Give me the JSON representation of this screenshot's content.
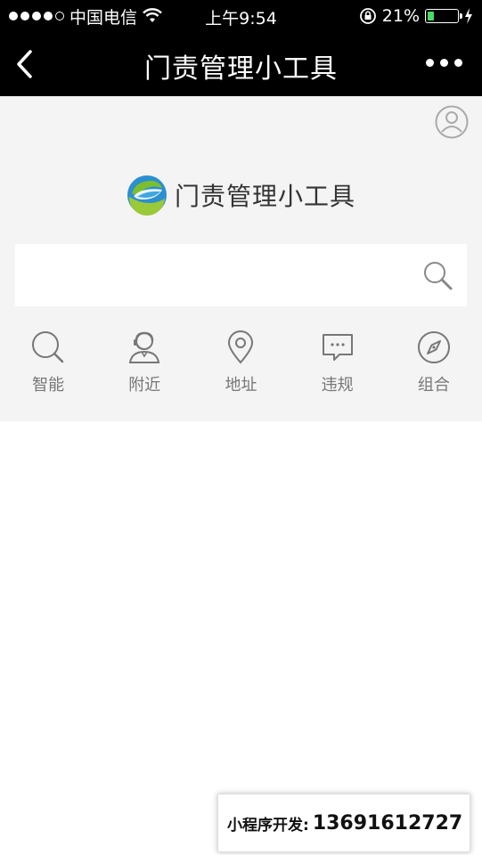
{
  "status_bar": {
    "carrier": "中国电信",
    "time": "上午9:54",
    "battery": "21%",
    "battery_level": 0.21
  },
  "nav": {
    "title": "门责管理小工具"
  },
  "logo": {
    "text": "门责管理小工具"
  },
  "search": {
    "value": "",
    "placeholder": ""
  },
  "tools": [
    {
      "label": "智能",
      "icon": "search-icon"
    },
    {
      "label": "附近",
      "icon": "customer-service-icon"
    },
    {
      "label": "地址",
      "icon": "location-pin-icon"
    },
    {
      "label": "违规",
      "icon": "chat-bubble-icon"
    },
    {
      "label": "组合",
      "icon": "compass-icon"
    }
  ],
  "developer": {
    "label": "小程序开发:",
    "phone": "13691612727"
  }
}
